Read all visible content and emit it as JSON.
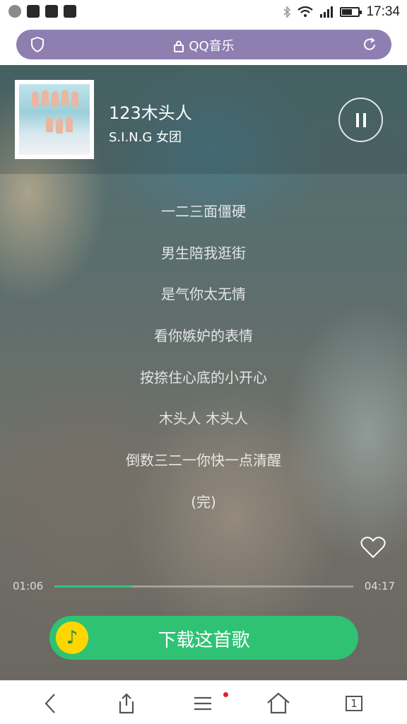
{
  "status_bar": {
    "time": "17:34",
    "battery_level": 0.55
  },
  "address_bar": {
    "title": "QQ音乐"
  },
  "player": {
    "song_title": "123木头人",
    "artist": "S.I.N.G 女团",
    "state": "playing",
    "lyrics": [
      "一二三面僵硬",
      "男生陪我逛街",
      "是气你太无情",
      "看你嫉妒的表情",
      "按捺住心底的小开心",
      "木头人 木头人",
      "倒数三二一你快一点清醒",
      "(完)"
    ],
    "elapsed": "01:06",
    "duration": "04:17",
    "progress_fraction": 0.257,
    "download_label": "下载这首歌"
  },
  "toolbar": {
    "tab_count": "1"
  },
  "colors": {
    "accent_green": "#2fc274",
    "address_bar": "#8e7fb0"
  }
}
